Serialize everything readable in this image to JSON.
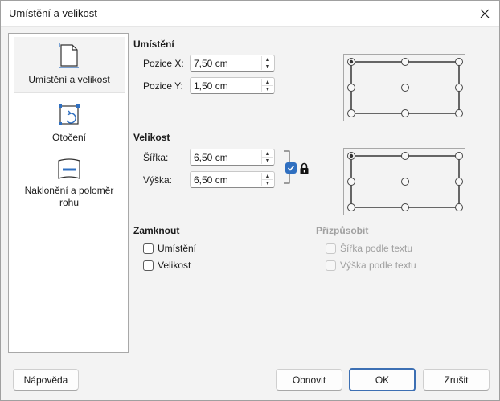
{
  "window": {
    "title": "Umístění a velikost"
  },
  "sidebar": {
    "items": [
      {
        "label": "Umístění a velikost",
        "icon": "page-icon",
        "active": true
      },
      {
        "label": "Otočení",
        "icon": "rotate-icon",
        "active": false
      },
      {
        "label": "Naklonění a poloměr rohu",
        "icon": "slant-icon",
        "active": false
      }
    ]
  },
  "position": {
    "title": "Umístění",
    "x_label": "Pozice X:",
    "x_value": "7,50 cm",
    "y_label": "Pozice Y:",
    "y_value": "1,50 cm",
    "base_point": "top-left"
  },
  "size": {
    "title": "Velikost",
    "width_label": "Šířka:",
    "width_value": "6,50 cm",
    "height_label": "Výška:",
    "height_value": "6,50 cm",
    "keep_ratio_checked": true,
    "base_point": "top-left"
  },
  "lock": {
    "title": "Zamknout",
    "position_label": "Umístění",
    "size_label": "Velikost"
  },
  "fit": {
    "title": "Přizpůsobit",
    "width_label": "Šířka podle textu",
    "height_label": "Výška podle textu"
  },
  "buttons": {
    "help": "Nápověda",
    "reset": "Obnovit",
    "ok": "OK",
    "cancel": "Zrušit"
  },
  "colors": {
    "accent": "#3c6fb3",
    "check": "#2f6fc0"
  }
}
